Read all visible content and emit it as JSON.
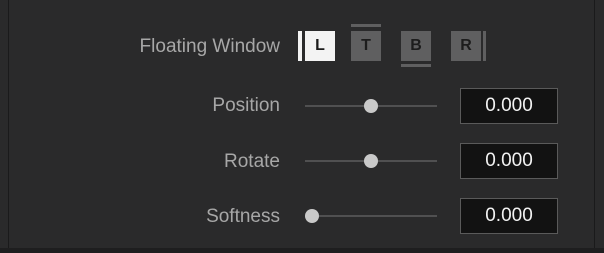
{
  "floating_window": {
    "label": "Floating Window",
    "buttons": [
      {
        "label": "L",
        "state": "active"
      },
      {
        "label": "T",
        "state": "inactive"
      },
      {
        "label": "B",
        "state": "inactive"
      },
      {
        "label": "R",
        "state": "inactive"
      }
    ]
  },
  "controls": [
    {
      "label": "Position",
      "value": "0.000",
      "slider_fraction": 0.5
    },
    {
      "label": "Rotate",
      "value": "0.000",
      "slider_fraction": 0.5
    },
    {
      "label": "Softness",
      "value": "0.000",
      "slider_fraction": 0.0
    }
  ],
  "colors": {
    "panel_background": "#2a2a2b",
    "label_text": "#a7a7a7",
    "active_button": "#f3f3f3",
    "inactive_button": "#5f5f60",
    "field_background": "#121212",
    "field_text": "#f2f2f2"
  }
}
